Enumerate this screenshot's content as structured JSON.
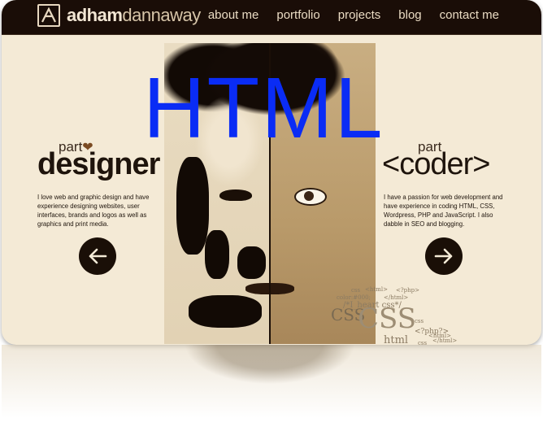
{
  "header": {
    "logo_bold": "adham",
    "logo_light": "dannaway",
    "nav": [
      "about me",
      "portfolio",
      "projects",
      "blog",
      "contact me"
    ]
  },
  "hero": {
    "left": {
      "part": "part",
      "heading": "designer",
      "blurb": "I love web and graphic design and have experience designing websites, user interfaces, brands and logos as well as graphics and print media."
    },
    "right": {
      "part": "part",
      "heading": "<coder>",
      "blurb": "I have a passion for web development and have experience in coding HTML, CSS, Wordpress, PHP and JavaScript. I also dabble in SEO and blogging."
    },
    "code_words": [
      "css",
      "<html>",
      "<?php>",
      "color:#000;",
      "</html>",
      "/*I_heart css*/",
      "CSS",
      "CSS",
      "<?php?>",
      "html",
      "css",
      "</html>",
      "css",
      "<html>"
    ]
  },
  "overlay": {
    "text": "HTML"
  },
  "colors": {
    "navbar": "#1a0d07",
    "background": "#f4ead6",
    "overlay_text": "#0a2cf5"
  },
  "icons": [
    "logo-mark-icon",
    "heart-icon",
    "arrow-left-icon",
    "arrow-right-icon"
  ]
}
